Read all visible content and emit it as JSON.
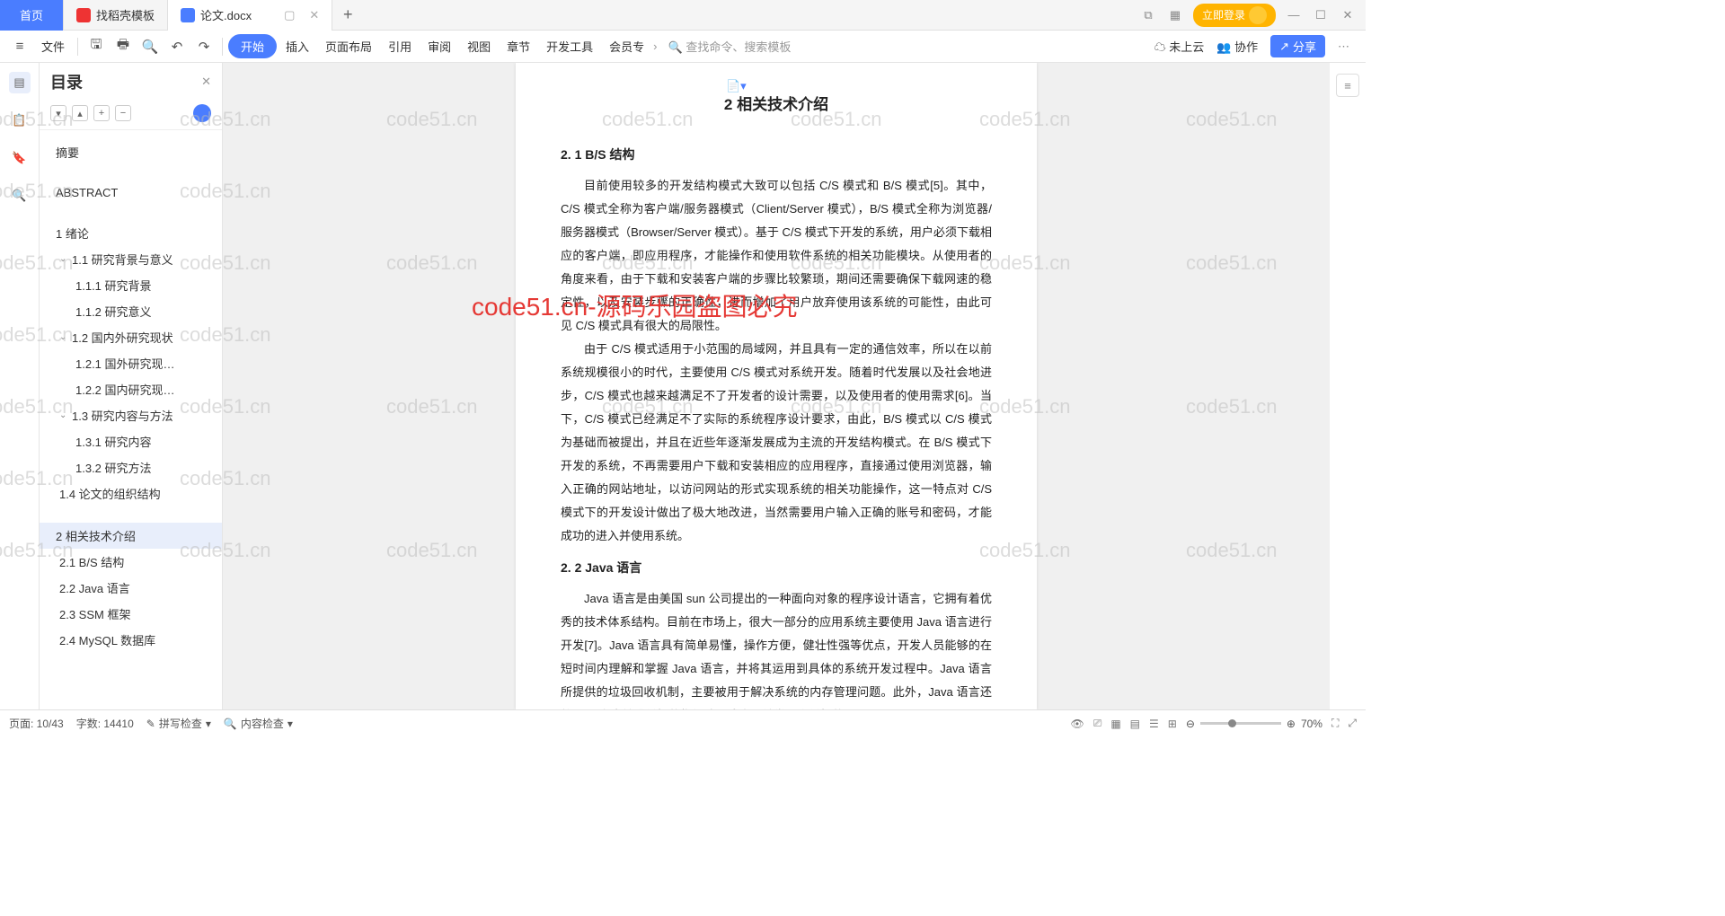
{
  "tabs": {
    "home": "首页",
    "t1": "找稻壳模板",
    "t2": "论文.docx",
    "add": "+",
    "login": "立即登录"
  },
  "menu": {
    "file": "文件",
    "start": "开始",
    "insert": "插入",
    "layout": "页面布局",
    "ref": "引用",
    "review": "审阅",
    "view": "视图",
    "chapter": "章节",
    "dev": "开发工具",
    "member": "会员专",
    "search": "查找命令、搜索模板",
    "cloud": "未上云",
    "collab": "协作",
    "share": "分享"
  },
  "sidebar": {
    "title": "目录"
  },
  "toc": [
    {
      "txt": "摘要",
      "lv": 1
    },
    {
      "txt": "ABSTRACT",
      "lv": 1,
      "gap": true
    },
    {
      "txt": "1 绪论",
      "lv": 1,
      "gap": true
    },
    {
      "txt": "1.1 研究背景与意义",
      "lv": 2,
      "exp": true
    },
    {
      "txt": "1.1.1 研究背景",
      "lv": 3
    },
    {
      "txt": "1.1.2 研究意义",
      "lv": 3
    },
    {
      "txt": "1.2 国内外研究现状",
      "lv": 2,
      "exp": true
    },
    {
      "txt": "1.2.1 国外研究现…",
      "lv": 3
    },
    {
      "txt": "1.2.2 国内研究现…",
      "lv": 3
    },
    {
      "txt": "1.3 研究内容与方法",
      "lv": 2,
      "exp": true
    },
    {
      "txt": "1.3.1 研究内容",
      "lv": 3
    },
    {
      "txt": "1.3.2 研究方法",
      "lv": 3
    },
    {
      "txt": "1.4 论文的组织结构",
      "lv": 2
    },
    {
      "txt": "2 相关技术介绍",
      "lv": 1,
      "gap": true,
      "sel": true
    },
    {
      "txt": "2.1 B/S 结构",
      "lv": 2
    },
    {
      "txt": "2.2 Java 语言",
      "lv": 2
    },
    {
      "txt": "2.3 SSM 框架",
      "lv": 2
    },
    {
      "txt": "2.4 MySQL 数据库",
      "lv": 2
    }
  ],
  "doc": {
    "h2": "2 相关技术介绍",
    "h3a": "2. 1  B/S 结构",
    "p1": "目前使用较多的开发结构模式大致可以包括 C/S 模式和 B/S 模式[5]。其中，C/S 模式全称为客户端/服务器模式（Client/Server 模式），B/S 模式全称为浏览器/服务器模式（Browser/Server 模式）。基于 C/S 模式下开发的系统，用户必须下载相应的客户端，即应用程序，才能操作和使用软件系统的相关功能模块。从使用者的角度来看，由于下载和安装客户端的步骤比较繁琐，期间还需要确保下载网速的稳定性，以及安装步骤的正确性，进而增加了用户放弃使用该系统的可能性，由此可见 C/S 模式具有很大的局限性。",
    "p2": "由于 C/S 模式适用于小范围的局域网，并且具有一定的通信效率，所以在以前系统规模很小的时代，主要使用 C/S 模式对系统开发。随着时代发展以及社会地进步，C/S 模式也越来越满足不了开发者的设计需要，以及使用者的使用需求[6]。当下，C/S 模式已经满足不了实际的系统程序设计要求，由此，B/S 模式以 C/S 模式为基础而被提出，并且在近些年逐渐发展成为主流的开发结构模式。在 B/S 模式下开发的系统，不再需要用户下载和安装相应的应用程序，直接通过使用浏览器，输入正确的网站地址，以访问网站的形式实现系统的相关功能操作，这一特点对 C/S 模式下的开发设计做出了极大地改进，当然需要用户输入正确的账号和密码，才能成功的进入并使用系统。",
    "h3b": "2. 2  Java 语言",
    "p3": "Java 语言是由美国 sun 公司提出的一种面向对象的程序设计语言，它拥有着优秀的技术体系结构。目前在市场上，很大一部分的应用系统主要使用 Java 语言进行开发[7]。Java 语言具有简单易懂，操作方便，健壮性强等优点，开发人员能够的在短时间内理解和掌握 Java 语言，并将其运用到具体的系统开发过程中。Java 语言所提供的垃圾回收机制，主要被用于解决系统的内存管理问题。此外，Java 语言还将 C 语言中较难掌握的指针改进成容易被学习和掌握的引用，"
  },
  "status": {
    "page": "页面: 10/43",
    "words": "字数: 14410",
    "spell": "拼写检查",
    "content": "内容检查",
    "zoom": "70%"
  },
  "overlay": "code51.cn-源码乐园盗图必究",
  "wm": "code51.cn"
}
